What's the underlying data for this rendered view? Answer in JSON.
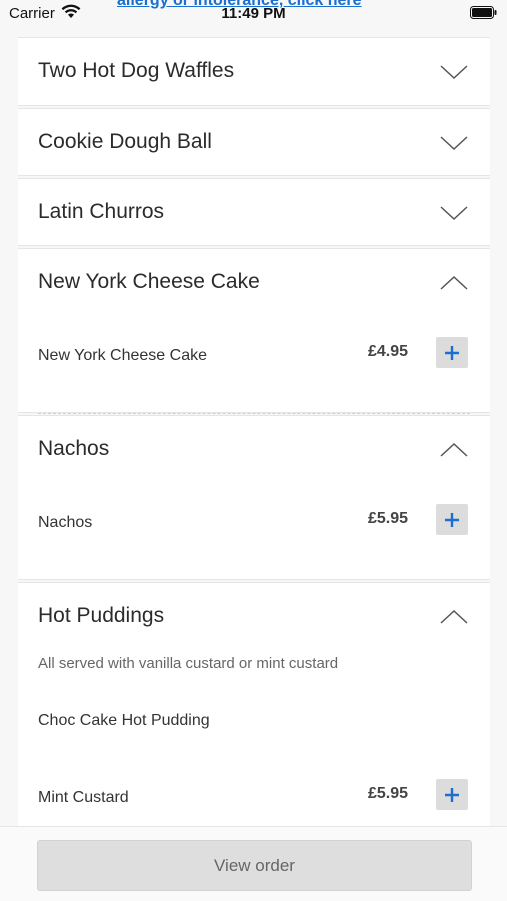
{
  "status_bar": {
    "carrier": "Carrier",
    "time": "11:49 PM",
    "icons": [
      "wifi-icon",
      "battery-icon"
    ]
  },
  "allergy_link": "allergy or intolerance, click here",
  "sections": [
    {
      "title": "Two Hot Dog Waffles",
      "expanded": false
    },
    {
      "title": "Cookie Dough Ball",
      "expanded": false
    },
    {
      "title": "Latin Churros",
      "expanded": false
    },
    {
      "title": "New York Cheese Cake",
      "expanded": true,
      "items": [
        {
          "name": "New York Cheese Cake",
          "price": "£4.95"
        }
      ]
    },
    {
      "title": "Nachos",
      "expanded": true,
      "items": [
        {
          "name": "Nachos",
          "price": "£5.95"
        }
      ]
    },
    {
      "title": "Hot Puddings",
      "expanded": true,
      "description": "All served with vanilla custard or mint custard",
      "subheading": "Choc Cake Hot Pudding",
      "items": [
        {
          "name": "Mint Custard",
          "price": "£5.95"
        }
      ]
    }
  ],
  "footer": {
    "view_order_label": "View order"
  },
  "colors": {
    "link": "#1a6fd1",
    "add_icon": "#1a6fd1",
    "button_bg": "#dedede"
  }
}
